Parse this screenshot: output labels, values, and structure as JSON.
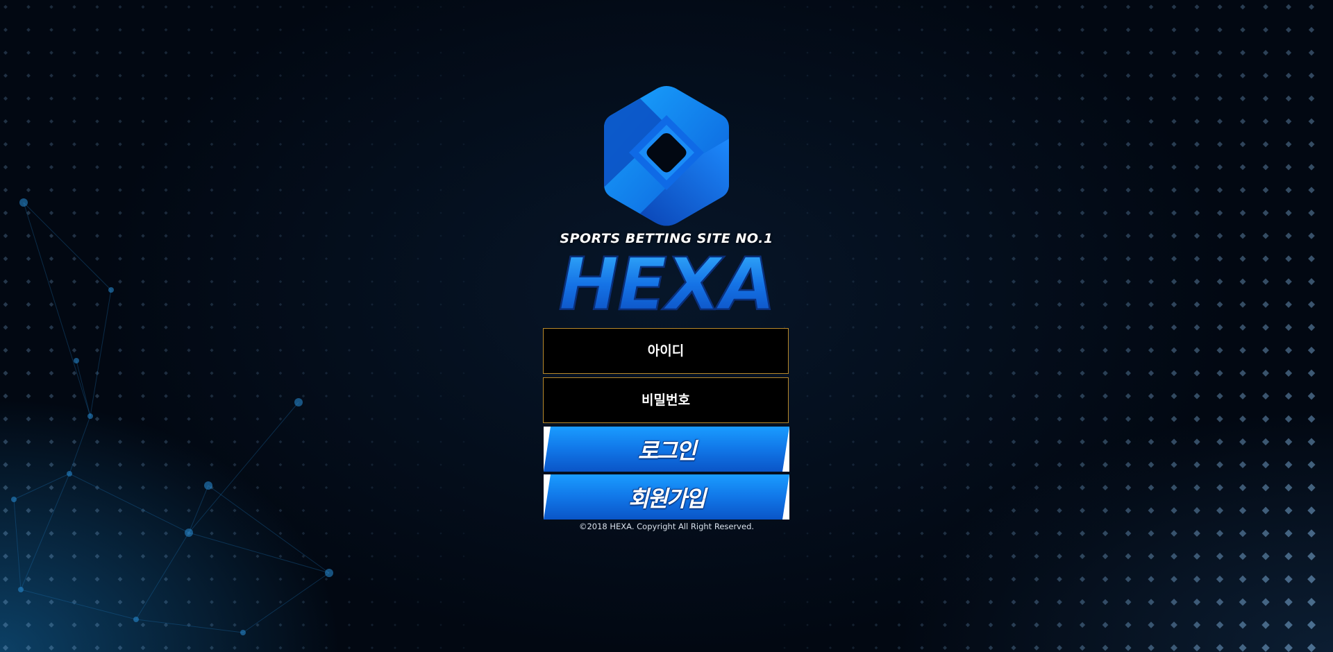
{
  "brand": {
    "tagline": "SPORTS BETTING SITE NO.1",
    "name": "HEXA",
    "logo_icon": "hexagon-logo-icon"
  },
  "login_form": {
    "id_placeholder": "아이디",
    "password_placeholder": "비밀번호",
    "login_label": "로그인",
    "signup_label": "회원가입"
  },
  "footer": {
    "copyright": "©2018 HEXA. Copyright All Right Reserved."
  },
  "colors": {
    "background": "#020812",
    "accent_blue": "#1177e8",
    "field_border": "#b8892a",
    "field_background": "#000000"
  }
}
